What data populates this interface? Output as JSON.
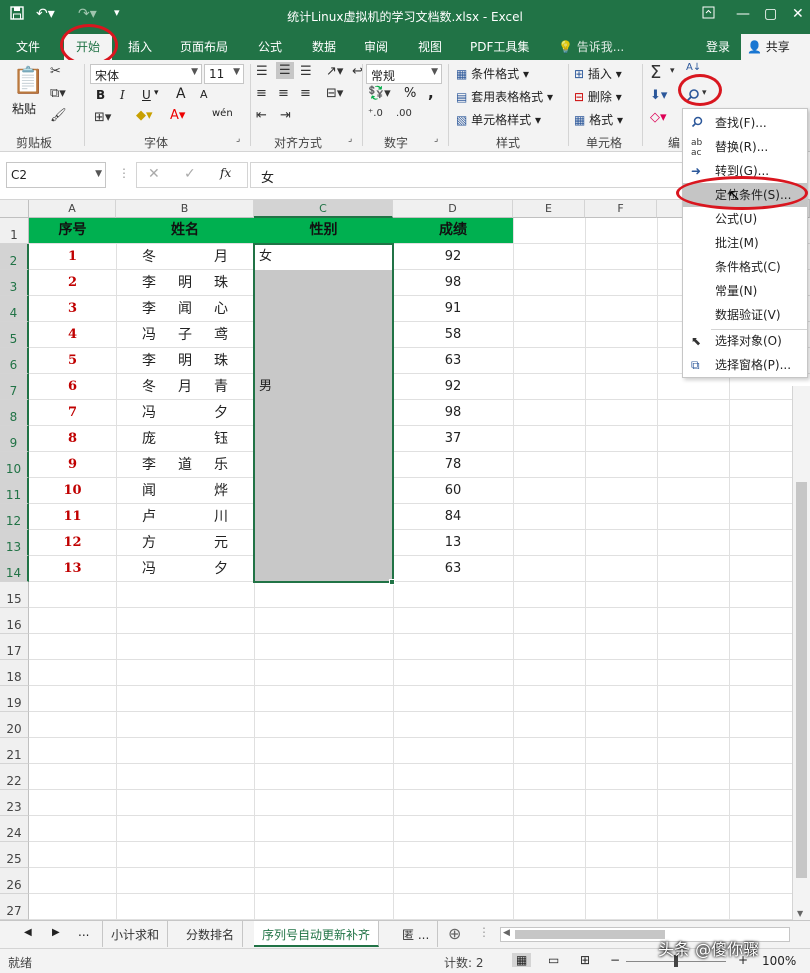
{
  "window": {
    "title": "统计Linux虚拟机的学习文档数.xlsx - Excel",
    "qa_save_icon": "save-icon",
    "undo_icon": "undo-icon",
    "redo_icon": "redo-icon",
    "custom_icon": "quick-access-customize-icon"
  },
  "tabs": {
    "file": "文件",
    "home": "开始",
    "insert": "插入",
    "page_layout": "页面布局",
    "formulas": "公式",
    "data": "数据",
    "review": "审阅",
    "view": "视图",
    "pdf": "PDF工具集",
    "tell_me": "告诉我...",
    "login": "登录",
    "share": "共享"
  },
  "ribbon": {
    "paste": "粘贴",
    "clipboard": "剪贴板",
    "font_name": "宋体",
    "font_size": "11",
    "font_group": "字体",
    "bold": "B",
    "italic": "I",
    "underline": "U",
    "grow_font": "A",
    "shrink_font": "A",
    "wen": "wén",
    "align_group": "对齐方式",
    "number_format": "常规",
    "percent": "%",
    "comma": ",",
    "number_group": "数字",
    "cond_format": "条件格式",
    "table_format": "套用表格格式",
    "cell_style": "单元格样式",
    "style_group": "样式",
    "insert": "插入",
    "delete": "删除",
    "format": "格式",
    "cells_group": "单元格",
    "edit_group": "编"
  },
  "formula_bar": {
    "name_box": "C2",
    "fx": "fx",
    "value": "女"
  },
  "columns": [
    "A",
    "B",
    "C",
    "D",
    "E",
    "F"
  ],
  "rows": [
    "1",
    "2",
    "3",
    "4",
    "5",
    "6",
    "7",
    "8",
    "9",
    "10",
    "11",
    "12",
    "13",
    "14",
    "15",
    "16",
    "17",
    "18",
    "19",
    "20",
    "21",
    "22",
    "23",
    "24",
    "25",
    "26",
    "27"
  ],
  "table": {
    "headers": [
      "序号",
      "姓名",
      "性别",
      "成绩"
    ],
    "seq": [
      "1",
      "2",
      "3",
      "4",
      "5",
      "6",
      "7",
      "8",
      "9",
      "10",
      "11",
      "12",
      "13"
    ],
    "names": [
      [
        "冬",
        "",
        "月"
      ],
      [
        "李",
        "明",
        "珠"
      ],
      [
        "李",
        "闻",
        "心"
      ],
      [
        "冯",
        "子",
        "鸢"
      ],
      [
        "李",
        "明",
        "珠"
      ],
      [
        "冬",
        "月",
        "青"
      ],
      [
        "冯",
        "",
        "夕"
      ],
      [
        "庞",
        "",
        "钰"
      ],
      [
        "李",
        "道",
        "乐"
      ],
      [
        "闻",
        "",
        "烨"
      ],
      [
        "卢",
        "",
        "川"
      ],
      [
        "方",
        "",
        "元"
      ],
      [
        "冯",
        "",
        "夕"
      ]
    ],
    "gender": [
      "女",
      "",
      "",
      "",
      "",
      "男",
      "",
      "",
      "",
      "",
      "",
      "",
      ""
    ],
    "scores": [
      "92",
      "98",
      "91",
      "58",
      "63",
      "92",
      "98",
      "37",
      "78",
      "60",
      "84",
      "13",
      "63"
    ]
  },
  "menu": {
    "items": [
      {
        "label": "查找(F)...",
        "icon": "find-icon"
      },
      {
        "label": "替换(R)...",
        "icon": "replace-icon"
      },
      {
        "label": "转到(G)...",
        "icon": "goto-arrow-icon"
      },
      {
        "label": "定位条件(S)...",
        "icon": ""
      },
      {
        "label": "公式(U)",
        "icon": ""
      },
      {
        "label": "批注(M)",
        "icon": ""
      },
      {
        "label": "条件格式(C)",
        "icon": ""
      },
      {
        "label": "常量(N)",
        "icon": ""
      },
      {
        "label": "数据验证(V)",
        "icon": ""
      },
      {
        "label": "选择对象(O)",
        "icon": "select-objects-icon"
      },
      {
        "label": "选择窗格(P)...",
        "icon": "selection-pane-icon"
      }
    ]
  },
  "sheets": {
    "ellipsis_left": "...",
    "items": [
      "小计求和",
      "分数排名",
      "序列号自动更新补齐",
      "匿 ..."
    ],
    "add": "⊕"
  },
  "status": {
    "ready": "就绪",
    "count": "计数: 2",
    "zoom": "100%",
    "watermark": "头条 @傻你骤"
  },
  "colors": {
    "excel_green": "#217346",
    "header_fill": "#00b050",
    "seq_red": "#c00000",
    "selection_gray": "#c0c0c0",
    "annotation_red": "#d9161f"
  }
}
